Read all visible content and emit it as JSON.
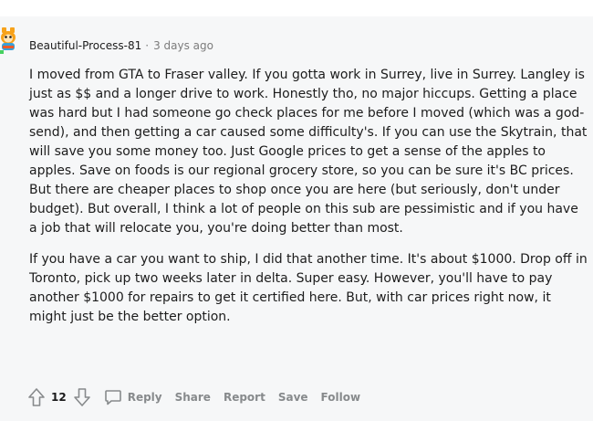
{
  "comment": {
    "username": "Beautiful-Process-81",
    "separator": "·",
    "timestamp": "3 days ago",
    "paragraphs": [
      "I moved from GTA to Fraser valley. If you gotta work in Surrey, live in Surrey. Langley is just as $$ and a longer drive to work. Honestly tho, no major hiccups. Getting a place was hard but I had someone go check places for me before I moved (which was a god-send), and then getting a car caused some difficulty's. If you can use the Skytrain, that will save you some money too. Just Google prices to get a sense of the apples to apples. Save on foods is our regional grocery store, so you can be sure it's BC prices. But there are cheaper places to shop once you are here (but seriously, don't under budget). But overall, I think a lot of people on this sub are pessimistic and if you have a job that will relocate you, you're doing better than most.",
      "If you have a car you want to ship, I did that another time. It's about $1000. Drop off in Toronto, pick up two weeks later in delta. Super easy. However, you'll have to pay another $1000 for repairs to get it certified here. But, with car prices right now, it might just be the better option."
    ]
  },
  "actions": {
    "score": "12",
    "reply_label": "Reply",
    "share_label": "Share",
    "report_label": "Report",
    "save_label": "Save",
    "follow_label": "Follow"
  },
  "icons": {
    "avatar": "snoo-avatar-icon",
    "upvote": "upvote-arrow-icon",
    "downvote": "downvote-arrow-icon",
    "reply": "speech-bubble-icon"
  },
  "colors": {
    "card_background": "#f6f7f8",
    "meta_text": "#7c7c7c",
    "action_text": "#878a8c",
    "avatar_accent": "#f7a21b"
  }
}
